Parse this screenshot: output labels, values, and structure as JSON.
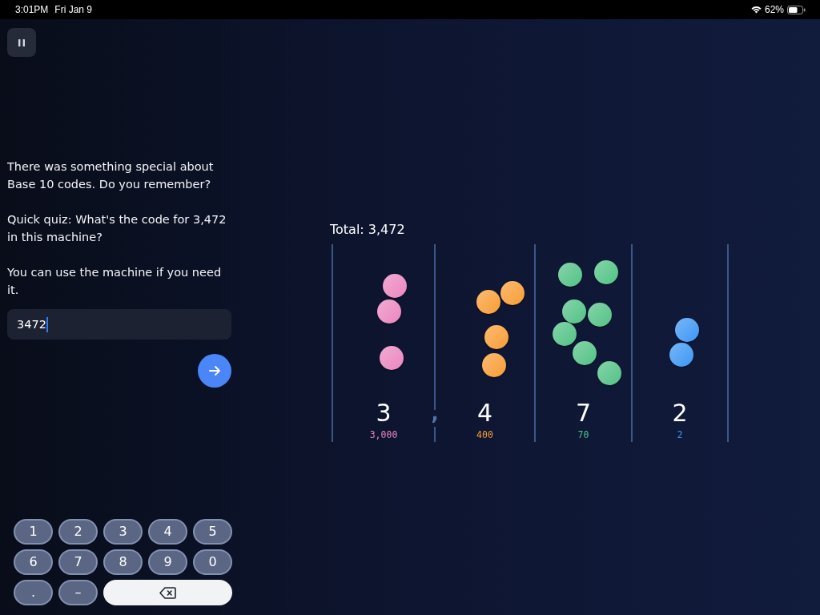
{
  "status_bar": {
    "time": "3:01PM",
    "date": "Fri Jan 9",
    "battery": "62%"
  },
  "prompt": {
    "paragraphs": [
      "There was something special about Base 10 codes. Do you remember?",
      "Quick quiz: What's the code for 3,472 in this machine?",
      "You can use the machine if you need it."
    ]
  },
  "answer": {
    "value": "3472",
    "focused": true
  },
  "machine": {
    "total": "Total: 3,472",
    "columns": [
      {
        "digit": "3",
        "value": "3,000",
        "color": "#ec86c0",
        "separator_after": ","
      },
      {
        "digit": "4",
        "value": "400",
        "color": "#f99d36"
      },
      {
        "digit": "7",
        "value": "70",
        "color": "#52c285"
      },
      {
        "digit": "2",
        "value": "2",
        "color": "#3d97f5"
      }
    ]
  },
  "keypad": {
    "keys": [
      {
        "kind": "key",
        "label": "1"
      },
      {
        "kind": "key",
        "label": "2"
      },
      {
        "kind": "key",
        "label": "3"
      },
      {
        "kind": "key",
        "label": "4"
      },
      {
        "kind": "key",
        "label": "5"
      },
      {
        "kind": "key",
        "label": "6"
      },
      {
        "kind": "key",
        "label": "7"
      },
      {
        "kind": "key",
        "label": "8"
      },
      {
        "kind": "key",
        "label": "9"
      },
      {
        "kind": "key",
        "label": "0"
      },
      {
        "kind": "key",
        "label": "."
      },
      {
        "kind": "key",
        "label": "–"
      },
      {
        "kind": "backspace"
      }
    ]
  }
}
